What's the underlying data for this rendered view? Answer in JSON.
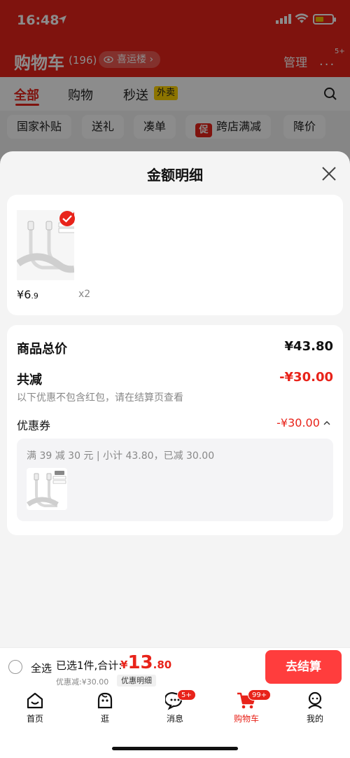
{
  "status_bar": {
    "time": "16:48"
  },
  "cart_header": {
    "title": "购物车",
    "count": "(196)",
    "address": "喜运楼",
    "manage": "管理",
    "more_badge": "5+"
  },
  "cart_tabs": [
    {
      "label": "全部"
    },
    {
      "label": "购物"
    },
    {
      "label": "秒送"
    }
  ],
  "waimai_tag": "外卖",
  "filter_chips": [
    {
      "label": "国家补贴"
    },
    {
      "label": "送礼"
    },
    {
      "label": "凑单"
    },
    {
      "label": "跨店满减",
      "icon_text": "促"
    },
    {
      "label": "降价"
    }
  ],
  "sheet": {
    "title": "金额明细",
    "product": {
      "price_yen": "¥",
      "price_int": "6",
      "price_dec": ".9",
      "qty": "x2"
    },
    "summary": {
      "total_label": "商品总价",
      "total_value": "¥43.80",
      "reduce_label": "共减",
      "reduce_value": "-¥30.00",
      "note": "以下优惠不包含红包，请在结算页查看",
      "coupon_label": "优惠券",
      "coupon_value": "-¥30.00",
      "coupon_desc": "满 39 减 30 元 | 小计 43.80，已减 30.00"
    }
  },
  "checkout": {
    "select_all": "全选",
    "selected_text": "已选1件,合计:",
    "total_currency": "¥",
    "total_int": "13",
    "total_dec": ".80",
    "discount_text": "优惠减:¥30.00",
    "detail_tag": "优惠明细",
    "button": "去结算"
  },
  "tabbar": [
    {
      "label": "首页",
      "icon": "home-icon"
    },
    {
      "label": "逛",
      "icon": "explore-icon"
    },
    {
      "label": "消息",
      "icon": "message-icon",
      "badge": "5+"
    },
    {
      "label": "购物车",
      "icon": "cart-icon",
      "badge": "99+",
      "active": true
    },
    {
      "label": "我的",
      "icon": "profile-icon"
    }
  ],
  "colors": {
    "brand_red": "#e8231a",
    "button_red": "#ff3d3d",
    "tag_yellow": "#ffd400"
  }
}
